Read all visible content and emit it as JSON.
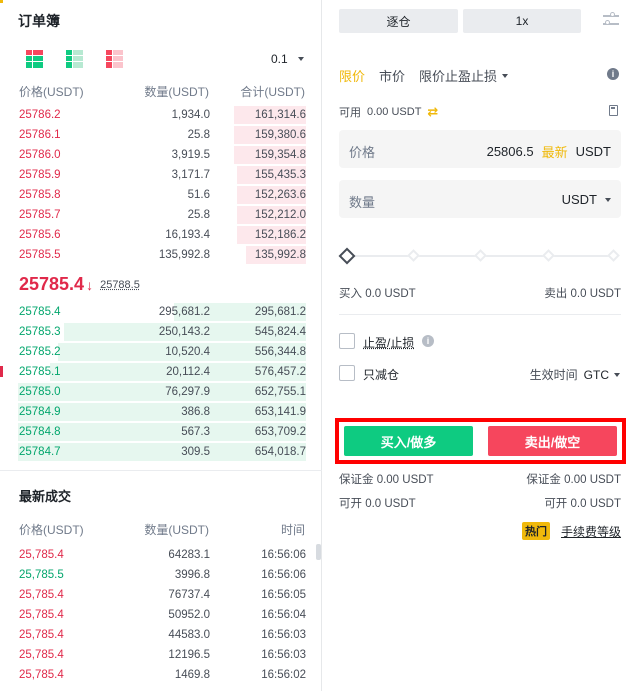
{
  "orderbook": {
    "title": "订单簿",
    "precision": "0.1",
    "headers": {
      "price": "价格(USDT)",
      "qty": "数量(USDT)",
      "total": "合计(USDT)"
    },
    "asks": [
      {
        "price": "25786.2",
        "qty": "1,934.0",
        "total": "161,314.6",
        "depth": 0.25
      },
      {
        "price": "25786.1",
        "qty": "25.8",
        "total": "159,380.6",
        "depth": 0.25
      },
      {
        "price": "25786.0",
        "qty": "3,919.5",
        "total": "159,354.8",
        "depth": 0.25
      },
      {
        "price": "25785.9",
        "qty": "3,171.7",
        "total": "155,435.3",
        "depth": 0.24
      },
      {
        "price": "25785.8",
        "qty": "51.6",
        "total": "152,263.6",
        "depth": 0.24
      },
      {
        "price": "25785.7",
        "qty": "25.8",
        "total": "152,212.0",
        "depth": 0.24
      },
      {
        "price": "25785.6",
        "qty": "16,193.4",
        "total": "152,186.2",
        "depth": 0.24
      },
      {
        "price": "25785.5",
        "qty": "135,992.8",
        "total": "135,992.8",
        "depth": 0.21
      }
    ],
    "mid_price": "25785.4",
    "mid_arrow": "↓",
    "mark_price": "25788.5",
    "bids": [
      {
        "price": "25785.4",
        "qty": "295,681.2",
        "total": "295,681.2",
        "depth": 0.46
      },
      {
        "price": "25785.3",
        "qty": "250,143.2",
        "total": "545,824.4",
        "depth": 0.84
      },
      {
        "price": "25785.2",
        "qty": "10,520.4",
        "total": "556,344.8",
        "depth": 0.86
      },
      {
        "price": "25785.1",
        "qty": "20,112.4",
        "total": "576,457.2",
        "depth": 0.89
      },
      {
        "price": "25785.0",
        "qty": "76,297.9",
        "total": "652,755.1",
        "depth": 1.0
      },
      {
        "price": "25784.9",
        "qty": "386.8",
        "total": "653,141.9",
        "depth": 1.0
      },
      {
        "price": "25784.8",
        "qty": "567.3",
        "total": "653,709.2",
        "depth": 1.0
      },
      {
        "price": "25784.7",
        "qty": "309.5",
        "total": "654,018.7",
        "depth": 1.0
      }
    ]
  },
  "trades": {
    "title": "最新成交",
    "headers": {
      "price": "价格(USDT)",
      "qty": "数量(USDT)",
      "time": "时间"
    },
    "rows": [
      {
        "price": "25,785.4",
        "qty": "64283.1",
        "time": "16:56:06",
        "side": "red"
      },
      {
        "price": "25,785.5",
        "qty": "3996.8",
        "time": "16:56:06",
        "side": "green"
      },
      {
        "price": "25,785.4",
        "qty": "76737.4",
        "time": "16:56:05",
        "side": "red"
      },
      {
        "price": "25,785.4",
        "qty": "50952.0",
        "time": "16:56:04",
        "side": "red"
      },
      {
        "price": "25,785.4",
        "qty": "44583.0",
        "time": "16:56:03",
        "side": "red"
      },
      {
        "price": "25,785.4",
        "qty": "12196.5",
        "time": "16:56:03",
        "side": "red"
      },
      {
        "price": "25,785.4",
        "qty": "1469.8",
        "time": "16:56:02",
        "side": "red"
      }
    ]
  },
  "trade_panel": {
    "margin_mode": "逐仓",
    "leverage": "1x",
    "tabs": [
      "限价",
      "市价",
      "限价止盈止损"
    ],
    "available_label": "可用",
    "available_value": "0.00 USDT",
    "price_label": "价格",
    "price_value": "25806.5",
    "price_latest": "最新",
    "price_unit": "USDT",
    "qty_label": "数量",
    "qty_unit": "USDT",
    "slider_level": 0,
    "buy_amount": "买入 0.0 USDT",
    "sell_amount": "卖出 0.0 USDT",
    "tpsl_label": "止盈/止损",
    "reduce_only_label": "只减仓",
    "tif_label": "生效时间",
    "tif_value": "GTC",
    "buy_button": "买入/做多",
    "sell_button": "卖出/做空",
    "buy_margin": "保证金 0.00 USDT",
    "sell_margin": "保证金 0.00 USDT",
    "buy_open": "可开 0.0 USDT",
    "sell_open": "可开 0.0 USDT",
    "hot_badge": "热门",
    "fee_link": "手续费等级"
  },
  "colors": {
    "sell": "#e0294a",
    "buy": "#03a66d",
    "accent": "#f0b90b",
    "buy_button": "#0ecb81",
    "sell_button": "#f6465d"
  }
}
